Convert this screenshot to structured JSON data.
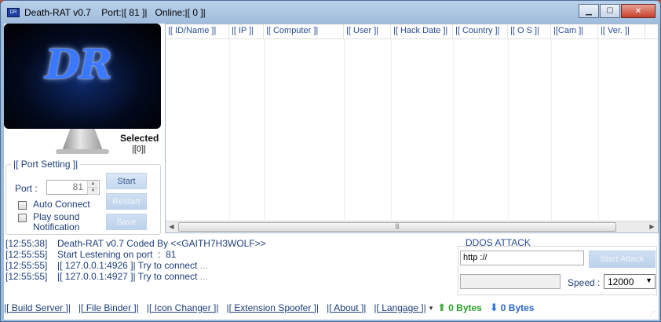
{
  "titlebar": {
    "title": "Death-RAT v0.7    Port:|[ 81 ]|   Online:|[ 0 ]|",
    "icon_label": "DR",
    "buttons": [
      "minimize",
      "maximize",
      "close"
    ]
  },
  "logo": {
    "text": "DR"
  },
  "selected": {
    "label": "Selected",
    "count": "|[0]|"
  },
  "port_setting": {
    "title": "|[ Port Setting ]|",
    "port_label": "Port :",
    "port_value": "81",
    "start_label": "Start",
    "restart_label": "Restart",
    "save_label": "Save",
    "auto_connect_label": "Auto Connect",
    "play_sound_label": "Play sound Notification"
  },
  "grid": {
    "columns": [
      "|[ ID/Name ]|",
      "|[ IP ]|",
      "|[ Computer ]|",
      "|[ User ]|",
      "|[ Hack Date ]|",
      "|[ Country ]|",
      "|[ O S ]|",
      "|[Cam ]|",
      "|[ Ver. ]|"
    ]
  },
  "log": [
    {
      "time": "[12:55:38]",
      "msg": "Death-RAT v0.7 Coded By <<GAITH7H3WOLF>>",
      "dots": ""
    },
    {
      "time": "[12:55:55]",
      "msg": "Start Lestening on port  :  81",
      "dots": ""
    },
    {
      "time": "[12:55:55]",
      "msg": "|[ 127.0.0.1:4926 ]| Try to connect ",
      "dots": "..."
    },
    {
      "time": "[12:55:55]",
      "msg": "|[ 127.0.0.1:4927 ]| Try to connect ",
      "dots": "..."
    }
  ],
  "ddos": {
    "title": "DDOS ATTACK",
    "url_value": "http ://",
    "start_attack_label": "Start Attack",
    "speed_label": "Speed  :",
    "speed_value": "12000"
  },
  "menu": {
    "items": [
      "|[ Build Server ]|",
      "|[ File Binder ]|",
      "|[ Icon Changer ]|",
      "|[ Extension Spoofer ]|",
      "|[ About ]|",
      "|[ Langage ]|"
    ],
    "upload": "0 Bytes",
    "download": "0 Bytes"
  }
}
